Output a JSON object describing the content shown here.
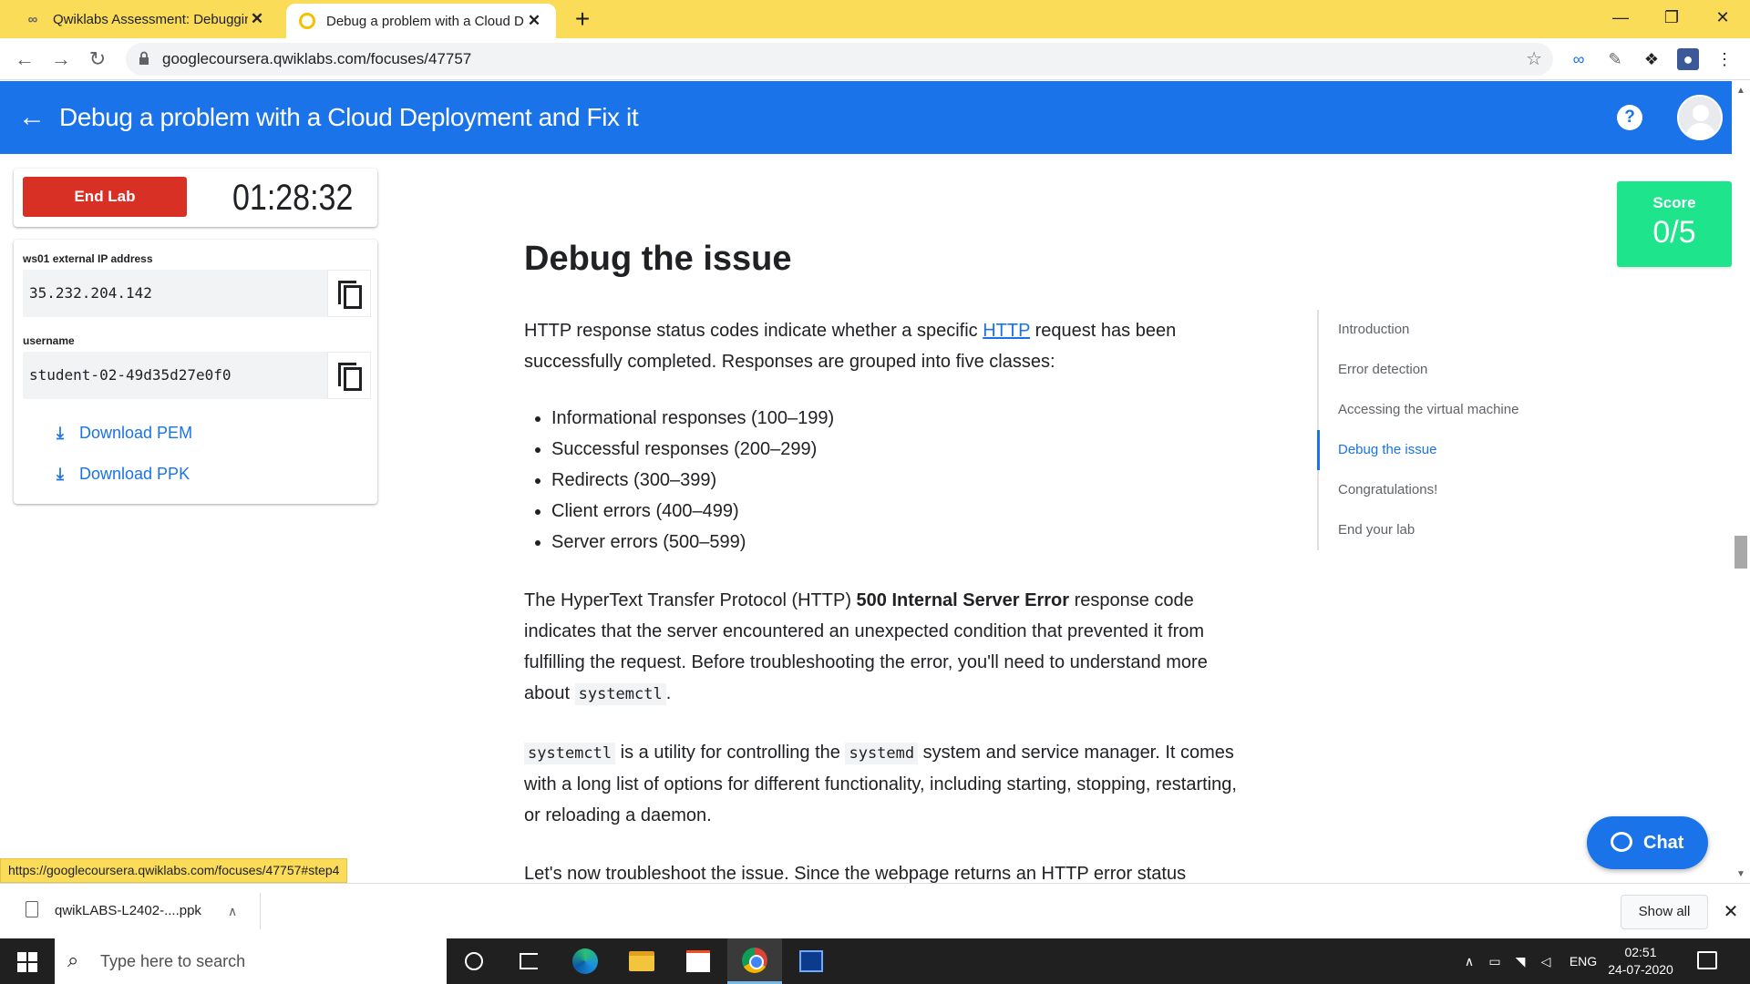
{
  "browser": {
    "tabs": [
      {
        "title": "Qwiklabs Assessment: Debugging",
        "favicon": "qwiklabs-icon"
      },
      {
        "title": "Debug a problem with a Cloud D",
        "favicon": "qwiklabs-lab-icon"
      }
    ],
    "url": "googlecoursera.qwiklabs.com/focuses/47757",
    "status_url": "https://googlecoursera.qwiklabs.com/focuses/47757#step4"
  },
  "header": {
    "title": "Debug a problem with a Cloud Deployment and Fix it",
    "help": "?"
  },
  "lab_panel": {
    "end_lab_label": "End Lab",
    "timer": "01:28:32",
    "ip_label": "ws01 external IP address",
    "ip_value": "35.232.204.142",
    "username_label": "username",
    "username_value": "student-02-49d35d27e0f0",
    "download_pem": "Download PEM",
    "download_ppk": "Download PPK"
  },
  "score": {
    "label": "Score",
    "value": "0/5"
  },
  "article": {
    "heading": "Debug the issue",
    "p1_before": "HTTP response status codes indicate whether a specific ",
    "p1_link": "HTTP",
    "p1_after": " request has been successfully completed. Responses are grouped into five classes:",
    "bullets": [
      "Informational responses (100–199)",
      "Successful responses (200–299)",
      "Redirects (300–399)",
      "Client errors (400–499)",
      "Server errors (500–599)"
    ],
    "p2_before": "The HyperText Transfer Protocol (HTTP) ",
    "p2_bold": "500 Internal Server Error",
    "p2_after": " response code indicates that the server encountered an unexpected condition that prevented it from fulfilling the request. Before troubleshooting the error, you'll need to understand more about ",
    "p2_code": "systemctl",
    "p2_end": ".",
    "p3_code1": "systemctl",
    "p3_mid": " is a utility for controlling the ",
    "p3_code2": "systemd",
    "p3_after": " system and service manager. It comes with a long list of options for different functionality, including starting, stopping, restarting, or reloading a daemon.",
    "p4": "Let's now troubleshoot the issue. Since the webpage returns an HTTP error status"
  },
  "toc": {
    "items": [
      {
        "label": "Introduction",
        "active": false
      },
      {
        "label": "Error detection",
        "active": false
      },
      {
        "label": "Accessing the virtual machine",
        "active": false
      },
      {
        "label": "Debug the issue",
        "active": true
      },
      {
        "label": "Congratulations!",
        "active": false
      },
      {
        "label": "End your lab",
        "active": false
      }
    ]
  },
  "chat": {
    "label": "Chat"
  },
  "download_shelf": {
    "file_name": "qwikLABS-L2402-....ppk",
    "show_all": "Show all"
  },
  "taskbar": {
    "search_placeholder": "Type here to search",
    "language": "ENG",
    "time": "02:51",
    "date": "24-07-2020"
  },
  "colors": {
    "header_blue": "#1a73e8",
    "tab_strip_yellow": "#fbdc58",
    "end_lab_red": "#d93025",
    "score_green": "#1ee58b"
  }
}
